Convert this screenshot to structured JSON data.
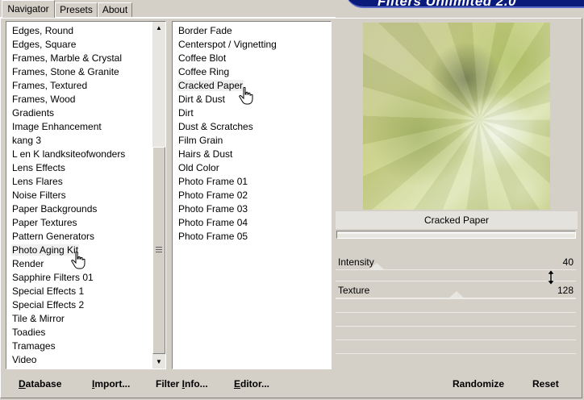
{
  "tabs": [
    {
      "label": "Navigator",
      "active": true
    },
    {
      "label": "Presets",
      "active": false
    },
    {
      "label": "About",
      "active": false
    }
  ],
  "banner": {
    "text": "Filters Unlimited 2.0"
  },
  "categories": {
    "items": [
      "Edges, Round",
      "Edges, Square",
      "Frames, Marble & Crystal",
      "Frames, Stone & Granite",
      "Frames, Textured",
      "Frames, Wood",
      "Gradients",
      "Image Enhancement",
      "kang 3",
      "L en K landksiteofwonders",
      "Lens Effects",
      "Lens Flares",
      "Noise Filters",
      "Paper Backgrounds",
      "Paper Textures",
      "Pattern Generators",
      "Photo Aging Kit",
      "Render",
      "Sapphire Filters 01",
      "Special Effects 1",
      "Special Effects 2",
      "Tile & Mirror",
      "Toadies",
      "Tramages",
      "Video"
    ],
    "selected": "Photo Aging Kit"
  },
  "filters": {
    "items": [
      "Border Fade",
      "Centerspot / Vignetting",
      "Coffee Blot",
      "Coffee Ring",
      "Cracked Paper",
      "Dirt & Dust",
      "Dirt",
      "Dust & Scratches",
      "Film Grain",
      "Hairs & Dust",
      "Old Color",
      "Photo Frame 01",
      "Photo Frame 02",
      "Photo Frame 03",
      "Photo Frame 04",
      "Photo Frame 05"
    ],
    "selected": "Cracked Paper"
  },
  "preview": {
    "filter_name": "Cracked Paper"
  },
  "parameters": [
    {
      "label": "Intensity",
      "value": "40",
      "max": 255
    },
    {
      "label": "Texture",
      "value": "128",
      "max": 255
    }
  ],
  "buttons": {
    "database": {
      "mnemonic": "D",
      "rest": "atabase"
    },
    "import": {
      "mnemonic": "I",
      "rest": "mport..."
    },
    "filter_info": {
      "pre": "Filter ",
      "mnemonic": "I",
      "rest": "nfo..."
    },
    "editor": {
      "mnemonic": "E",
      "rest": "ditor..."
    },
    "randomize": "Randomize",
    "reset": "Reset"
  },
  "icons": {
    "hand_cursor": "hand-cursor-icon",
    "resize_cursor": "vertical-resize-cursor-icon"
  }
}
